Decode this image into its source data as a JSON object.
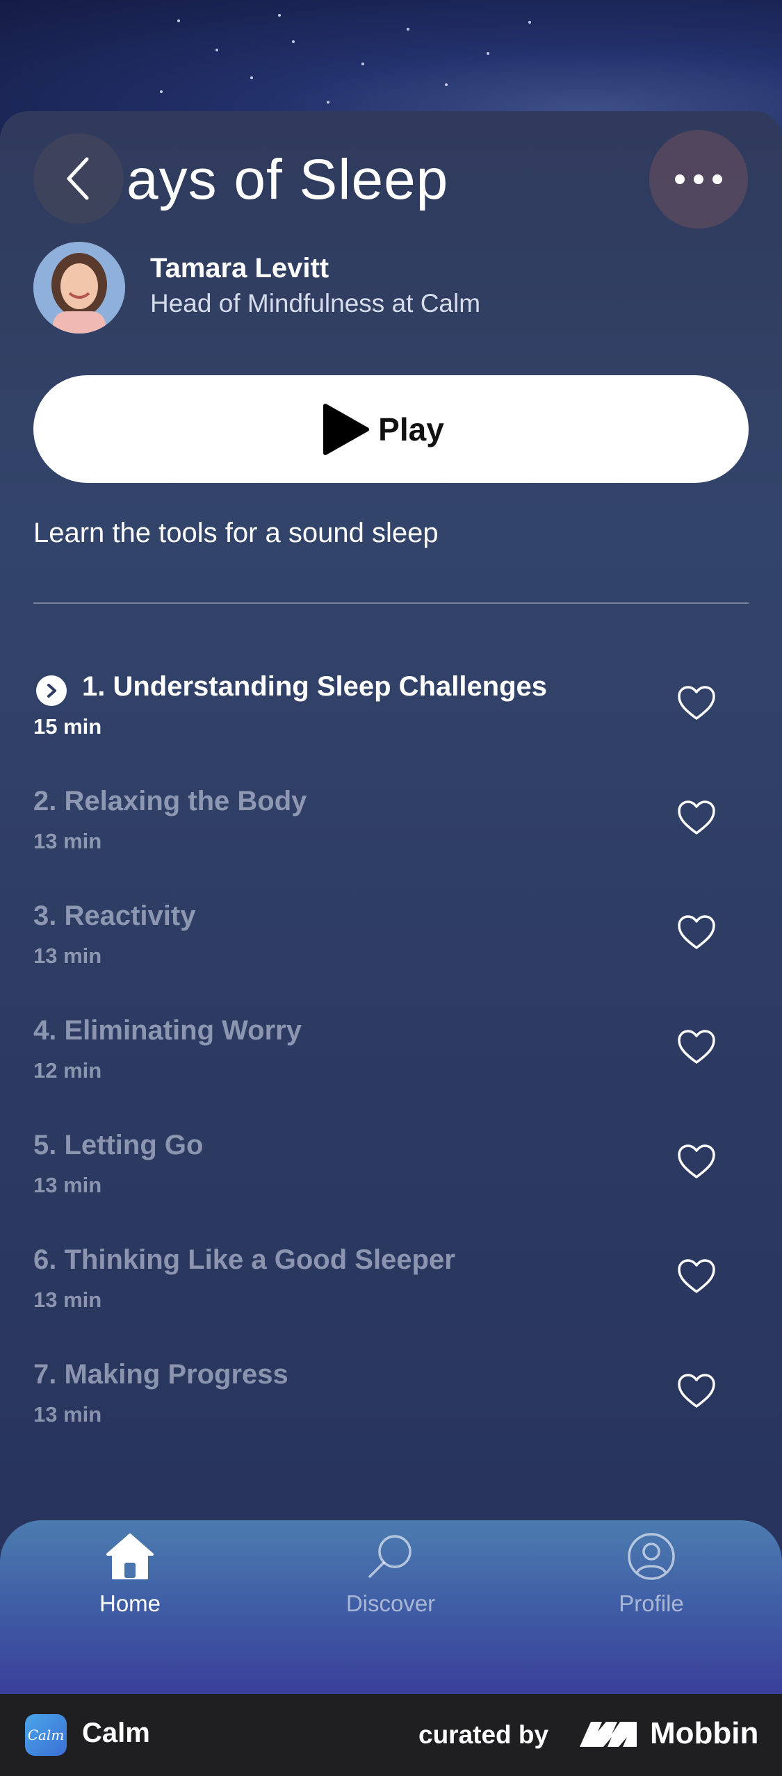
{
  "header": {
    "title": "ays of Sleep",
    "back_icon": "chevron-left-icon",
    "more_icon": "ellipsis-icon"
  },
  "author": {
    "name": "Tamara Levitt",
    "role": "Head of Mindfulness at Calm"
  },
  "play_button": {
    "label": "Play"
  },
  "description": "Learn the tools for a sound sleep",
  "tracks": [
    {
      "title": "1. Understanding Sleep Challenges",
      "duration": "15 min"
    },
    {
      "title": "2. Relaxing the Body",
      "duration": "13 min"
    },
    {
      "title": "3. Reactivity",
      "duration": "13 min"
    },
    {
      "title": "4. Eliminating Worry",
      "duration": "12 min"
    },
    {
      "title": "5. Letting Go",
      "duration": "13 min"
    },
    {
      "title": "6. Thinking Like a Good Sleeper",
      "duration": "13 min"
    },
    {
      "title": "7. Making Progress",
      "duration": "13 min"
    }
  ],
  "tabs": [
    {
      "label": "Home",
      "icon": "home-icon"
    },
    {
      "label": "Discover",
      "icon": "search-icon"
    },
    {
      "label": "Profile",
      "icon": "profile-icon"
    }
  ],
  "footer": {
    "app_name": "Calm",
    "app_icon_text": "Calm",
    "curated_by": "curated by",
    "brand": "Mobbin"
  },
  "colors": {
    "background": "#2d3b62",
    "tabbar": "#3e5aa3",
    "accent": "#ffffff"
  }
}
